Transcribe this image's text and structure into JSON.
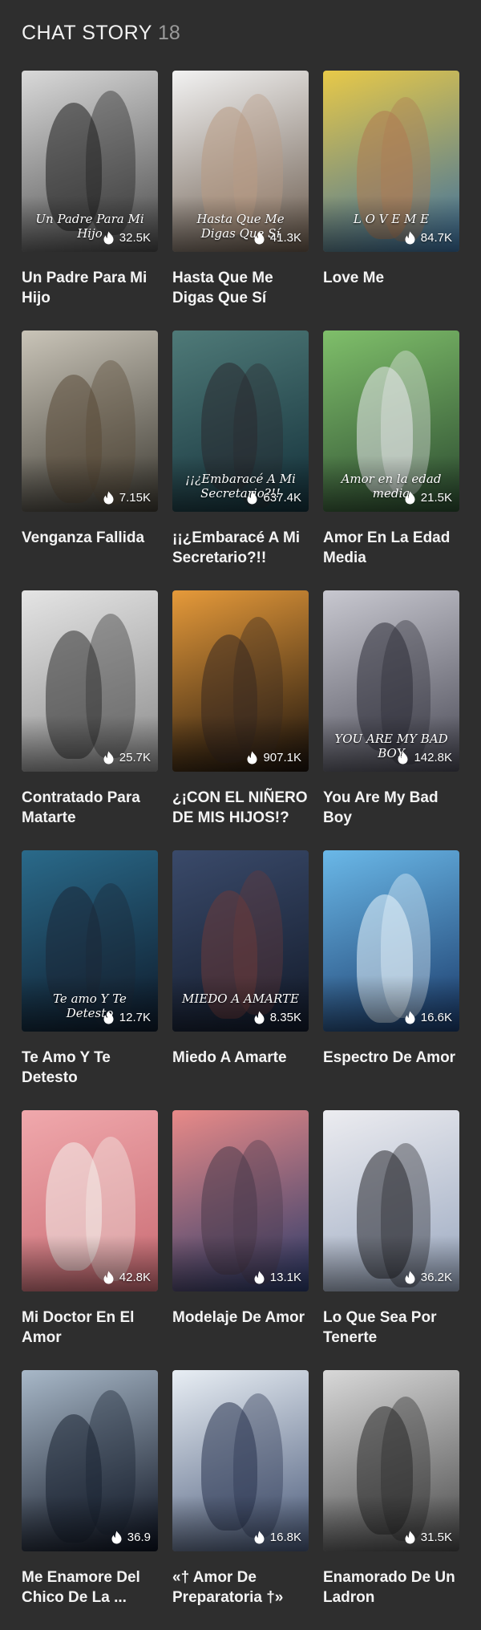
{
  "header": {
    "title": "CHAT STORY",
    "count": "18"
  },
  "stories": [
    {
      "title": "Un Padre Para Mi Hijo",
      "reads": "32.5K",
      "overlay": "Un Padre Para Mi Hijo",
      "bg1": "#d9d9d9",
      "bg2": "#4a4a4a",
      "fig": "#1e1e1e"
    },
    {
      "title": "Hasta Que Me Digas Que Sí",
      "reads": "41.3K",
      "overlay": "Hasta Que Me Digas Que Sí",
      "bg1": "#f2f2f2",
      "bg2": "#6a5a4c",
      "fig": "#b89a84"
    },
    {
      "title": "Love Me",
      "reads": "84.7K",
      "overlay": "L O V E  M E",
      "bg1": "#e8c948",
      "bg2": "#3a6fa0",
      "fig": "#b07a52"
    },
    {
      "title": "Venganza Fallida",
      "reads": "7.15K",
      "overlay": "",
      "bg1": "#c9c4b8",
      "bg2": "#3d3a32",
      "fig": "#5a4a38"
    },
    {
      "title": "¡¡¿Embaracé A Mi Secretario?!!",
      "reads": "637.4K",
      "overlay": "¡¡¿Embaracé A Mi Secretario?!!",
      "bg1": "#4f7a78",
      "bg2": "#13303a",
      "fig": "#2a2a30"
    },
    {
      "title": "Amor En La Edad Media",
      "reads": "21.5K",
      "overlay": "Amor en la edad media",
      "bg1": "#7fbf6a",
      "bg2": "#2b4a30",
      "fig": "#e8e8ec"
    },
    {
      "title": "Contratado Para Matarte",
      "reads": "25.7K",
      "overlay": "",
      "bg1": "#e4e4e4",
      "bg2": "#8a8a8a",
      "fig": "#303030"
    },
    {
      "title": "¿¡CON EL NIÑERO DE MIS HIJOS!?",
      "reads": "907.1K",
      "overlay": "",
      "bg1": "#e69a3a",
      "bg2": "#1a120c",
      "fig": "#3a2a20"
    },
    {
      "title": "You Are My Bad Boy",
      "reads": "142.8K",
      "overlay": "YOU ARE MY BAD BOY",
      "bg1": "#c8c8d0",
      "bg2": "#4a4a56",
      "fig": "#2e2e38"
    },
    {
      "title": "Te Amo Y Te Detesto",
      "reads": "12.7K",
      "overlay": "Te amo Y Te Detesto",
      "bg1": "#2a6a8a",
      "bg2": "#0e1a2a",
      "fig": "#1c2838"
    },
    {
      "title": "Miedo A Amarte",
      "reads": "8.35K",
      "overlay": "MIEDO A AMARTE",
      "bg1": "#3a4a6a",
      "bg2": "#121a2a",
      "fig": "#6a3a3a"
    },
    {
      "title": "Espectro De Amor",
      "reads": "16.6K",
      "overlay": "",
      "bg1": "#6ab8e8",
      "bg2": "#1a3a6a",
      "fig": "#e8f4fc"
    },
    {
      "title": "Mi Doctor En El Amor",
      "reads": "42.8K",
      "overlay": "",
      "bg1": "#f0a8ac",
      "bg2": "#c86a72",
      "fig": "#f4f0ec"
    },
    {
      "title": "Modelaje De Amor",
      "reads": "13.1K",
      "overlay": "",
      "bg1": "#e88a88",
      "bg2": "#2a3a6a",
      "fig": "#4a3a4a"
    },
    {
      "title": "Lo Que Sea Por Tenerte",
      "reads": "36.2K",
      "overlay": "",
      "bg1": "#ececf0",
      "bg2": "#9aa8c0",
      "fig": "#2a2a30"
    },
    {
      "title": "Me Enamore Del Chico De La ...",
      "reads": "36.9",
      "overlay": "",
      "bg1": "#a8b8c8",
      "bg2": "#0c1220",
      "fig": "#1a2232"
    },
    {
      "title": "«† Amor De Preparatoria †»",
      "reads": "16.8K",
      "overlay": "",
      "bg1": "#e8eef4",
      "bg2": "#4a5a7a",
      "fig": "#2a3450"
    },
    {
      "title": "Enamorado De Un Ladron",
      "reads": "31.5K",
      "overlay": "",
      "bg1": "#d8d8d8",
      "bg2": "#4a4a4a",
      "fig": "#2a2a2a"
    }
  ]
}
